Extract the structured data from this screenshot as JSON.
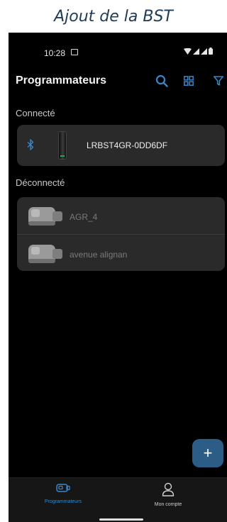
{
  "caption": "Ajout de la BST",
  "status_bar": {
    "time": "10:28"
  },
  "app_bar": {
    "title": "Programmateurs",
    "icons": [
      "search-icon",
      "grid-view-icon",
      "filter-icon"
    ]
  },
  "sections": {
    "connected": {
      "label": "Connecté",
      "devices": [
        {
          "name": "LRBST4GR-0DD6DF",
          "icon": "bluetooth-icon"
        }
      ]
    },
    "disconnected": {
      "label": "Déconnecté",
      "devices": [
        {
          "name": "AGR_4"
        },
        {
          "name": "avenue alignan"
        }
      ]
    }
  },
  "fab": {
    "label": "+"
  },
  "bottom_nav": {
    "items": [
      {
        "label": "Programmateurs",
        "icon": "programmer-icon",
        "active": true
      },
      {
        "label": "Mon compte",
        "icon": "account-icon",
        "active": false
      }
    ]
  },
  "colors": {
    "accent": "#3a86c8",
    "caption_text": "#1f3b57",
    "card_bg": "#2a2a2a",
    "fab_bg": "#2b5d87"
  }
}
